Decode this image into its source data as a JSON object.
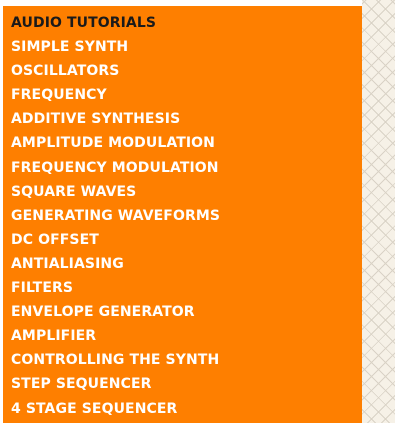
{
  "menu": {
    "header": "AUDIO TUTORIALS",
    "items": [
      "SIMPLE SYNTH",
      "OSCILLATORS",
      "FREQUENCY",
      "ADDITIVE SYNTHESIS",
      "AMPLITUDE MODULATION",
      "FREQUENCY MODULATION",
      "SQUARE WAVES",
      "GENERATING WAVEFORMS",
      "DC OFFSET",
      "ANTIALIASING",
      "FILTERS",
      "ENVELOPE GENERATOR",
      "AMPLIFIER",
      "CONTROLLING THE SYNTH",
      "STEP SEQUENCER",
      "4 STAGE SEQUENCER"
    ]
  },
  "colors": {
    "menu_background": "#fe7f00",
    "item_text": "#ffffff",
    "header_text": "#1a1a1a",
    "pattern_background": "#f6f1e7"
  }
}
